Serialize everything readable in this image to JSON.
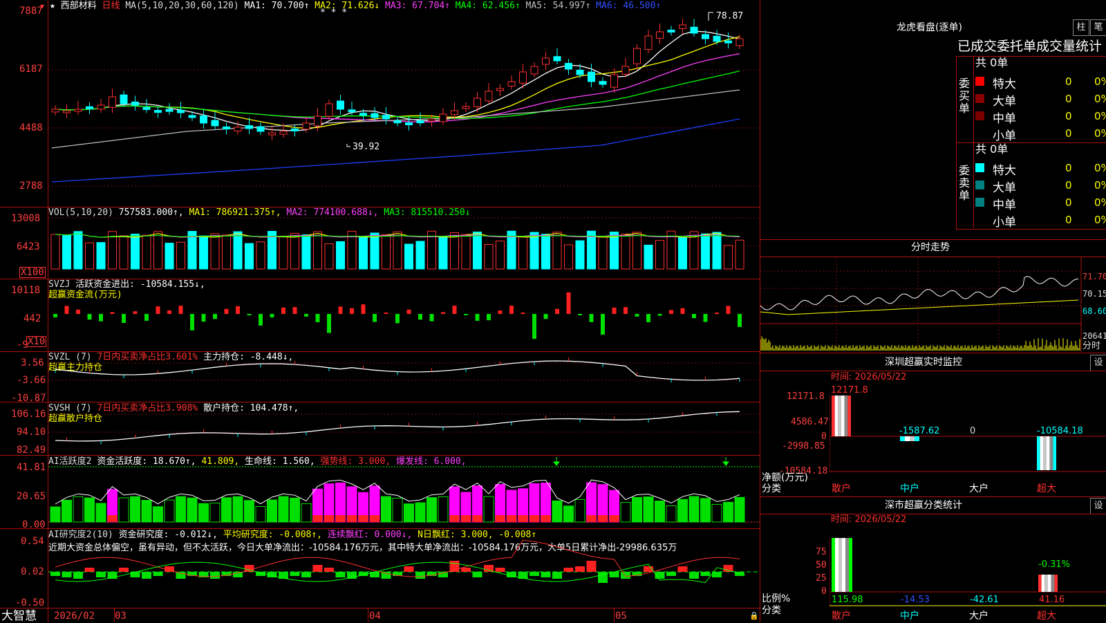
{
  "main": {
    "title_star": "★",
    "stock_name": "西部材料",
    "period": "日线",
    "ma_params": "MA(5,10,20,30,60,120)",
    "ma1": "MA1: 70.700↑",
    "ma2": "MA2: 71.626↓",
    "ma3": "MA3: 67.704↑",
    "ma4": "MA4: 62.456↑",
    "ma5": "MA5: 54.997↑",
    "ma6": "MA6: 46.500↑",
    "stars": "* * *",
    "y_labels": [
      "7887",
      "6187",
      "4488",
      "2788"
    ],
    "high_label": "78.87",
    "low_label": "39.92",
    "colors": {
      "up": "#ff3030",
      "down": "#00ffff",
      "ma1": "#ffffff",
      "ma2": "#ffff00",
      "ma3": "#ff40ff",
      "ma4": "#00ff00",
      "ma5": "#c0c0c0",
      "ma6": "#2040ff"
    }
  },
  "vol": {
    "title": "VOL(5,10,20)",
    "value": "757583.000↑,",
    "ma1": "MA1: 786921.375↑,",
    "ma2": "MA2: 774100.688↓,",
    "ma3": "MA3: 815510.250↓",
    "y_labels": [
      "13008",
      "6423"
    ],
    "unit": "X100"
  },
  "svzj": {
    "title": "SVZJ",
    "desc": "活跃资金进出: -10584.155↓,",
    "sub": "超赢资金流(万元)",
    "y_labels": [
      "10118",
      "442",
      "-9"
    ],
    "unit": "X10"
  },
  "svzl": {
    "title": "SVZL (7)",
    "desc1": "7日内买卖净占比3.601%",
    "desc2": "主力持仓: -8.448↓,",
    "sub": "超赢主力持仓",
    "y_labels": [
      "3.56",
      "-3.66",
      "-10.87"
    ]
  },
  "svsh": {
    "title": "SVSH (7)",
    "desc1": "7日内买卖净占比3.908%",
    "desc2": "散户持仓: 104.478↑,",
    "sub": "超赢散户持仓",
    "y_labels": [
      "106.16",
      "94.10",
      "82.49"
    ]
  },
  "ai1": {
    "title": "AI活跃度2",
    "d1": "资金活跃度: 18.670↑,",
    "d2": "41.809,",
    "d3": "生命线: 1.560,",
    "d4": "强势线: 3.000,",
    "d5": "爆发线: 6.000,",
    "y_labels": [
      "41.81",
      "20.65",
      "0.00"
    ]
  },
  "ai2": {
    "title": "AI研究度2(10)",
    "d1": "资金研究度: -0.012↓,",
    "d2": "平均研究度: -0.008↑,",
    "d3": "连续飘红: 0.000↓,",
    "d4": "N日飘红: 3.000, -0.008↑",
    "comment": "近期大资金总体偏空，虽有异动，但不太活跃，今日大单净流出：-10584.176万元，其中特大单净流出：-10584.176万元，大单5日累计净出-29986.635万",
    "y_labels": [
      "0.54",
      "0.02",
      "-0.50"
    ]
  },
  "bottom": {
    "app_name": "大智慧",
    "dates": [
      "2026/02",
      "03",
      "04",
      "05"
    ]
  },
  "right": {
    "longhu_title": "龙虎看盘(逐单)",
    "btn_zhu": "柱",
    "btn_bi": "笔",
    "headline": "已成交委托单成交量统计",
    "buy_label": "委买单",
    "sell_label": "委卖单",
    "buy_total": "共 0单",
    "sell_total": "共 0单",
    "buy_rows": [
      {
        "name": "特大",
        "count": "0",
        "pct": "0%",
        "color": "#ff0000"
      },
      {
        "name": "大单",
        "count": "0",
        "pct": "0%",
        "color": "#8b0000"
      },
      {
        "name": "中单",
        "count": "0",
        "pct": "0%",
        "color": "#7a0000"
      },
      {
        "name": "小单",
        "count": "0",
        "pct": "0%",
        "color": ""
      }
    ],
    "sell_rows": [
      {
        "name": "特大",
        "count": "0",
        "pct": "0%",
        "color": "#00ffff"
      },
      {
        "name": "大单",
        "count": "0",
        "pct": "0%",
        "color": "#008080"
      },
      {
        "name": "中单",
        "count": "0",
        "pct": "0%",
        "color": "#008080"
      },
      {
        "name": "小单",
        "count": "0",
        "pct": "0%",
        "color": ""
      }
    ],
    "fenshi_title": "分时走势",
    "fenshi_prices": [
      "71.70",
      "70.15",
      "68.60"
    ],
    "fenshi_vol": "20641",
    "fenshi_vol_label": "分时",
    "monitor_title": "深圳超赢实时监控",
    "monitor_btn": "设",
    "monitor_time": "时间: 2026/05/22",
    "monitor_top": "12171.8",
    "monitor_y": [
      "12171.8",
      "4586.47",
      "0",
      "-2998.85",
      "-10584.18"
    ],
    "monitor_vals": [
      "-1587.62",
      "0",
      "-10584.18"
    ],
    "monitor_ylabel1": "净额(万元)",
    "monitor_ylabel2": "分类",
    "monitor_cats": [
      "散户",
      "中户",
      "大户",
      "超大"
    ],
    "stats_title": "深市超赢分类统计",
    "stats_btn": "设",
    "stats_time": "时间: 2026/05/22",
    "stats_y": [
      "75",
      "50",
      "25",
      "0"
    ],
    "stats_top_label": "-0.31%",
    "stats_vals": [
      "115.98",
      "-14.53",
      "-42.61",
      "41.16"
    ],
    "stats_ylabel1": "比例%",
    "stats_ylabel2": "分类",
    "stats_cats": [
      "散户",
      "中户",
      "大户",
      "超大"
    ]
  }
}
